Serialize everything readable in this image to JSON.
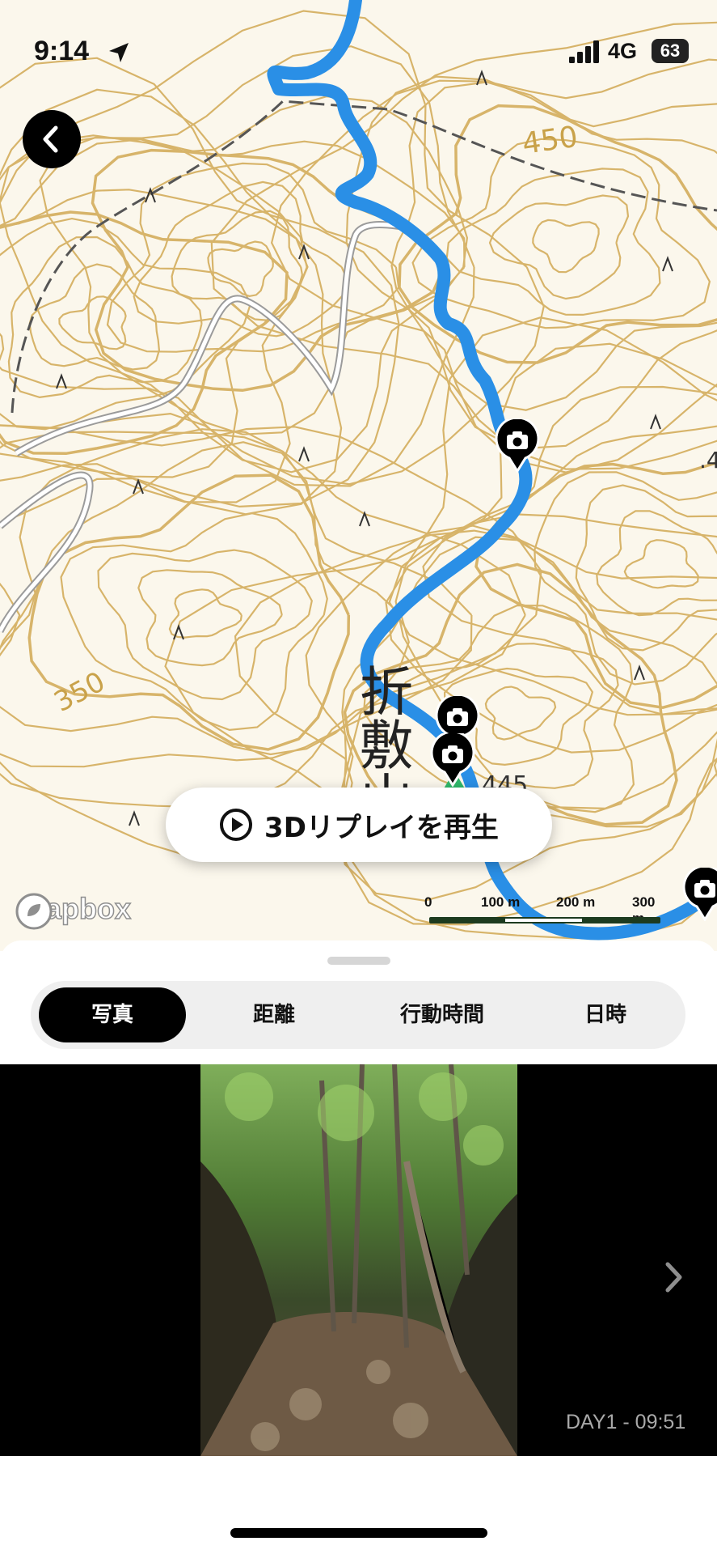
{
  "status_bar": {
    "time": "9:14",
    "network": "4G",
    "battery": "63"
  },
  "map": {
    "contour_labels": [
      "450",
      "350",
      "445",
      ".4"
    ],
    "place_name": "折敷山",
    "provider": "mapbox",
    "scale_labels": [
      "0",
      "100 m",
      "200 m",
      "300 m"
    ],
    "route_color": "#2a8fe6",
    "contour_color": "#c9a24a"
  },
  "replay": {
    "label": "3Dリプレイを再生",
    "icon": "play-circle-icon"
  },
  "tabs": [
    {
      "label": "写真",
      "active": true
    },
    {
      "label": "距離",
      "active": false
    },
    {
      "label": "行動時間",
      "active": false
    },
    {
      "label": "日時",
      "active": false
    }
  ],
  "photo": {
    "caption": "DAY1 - 09:51",
    "subject": "forest-trail-photo"
  }
}
